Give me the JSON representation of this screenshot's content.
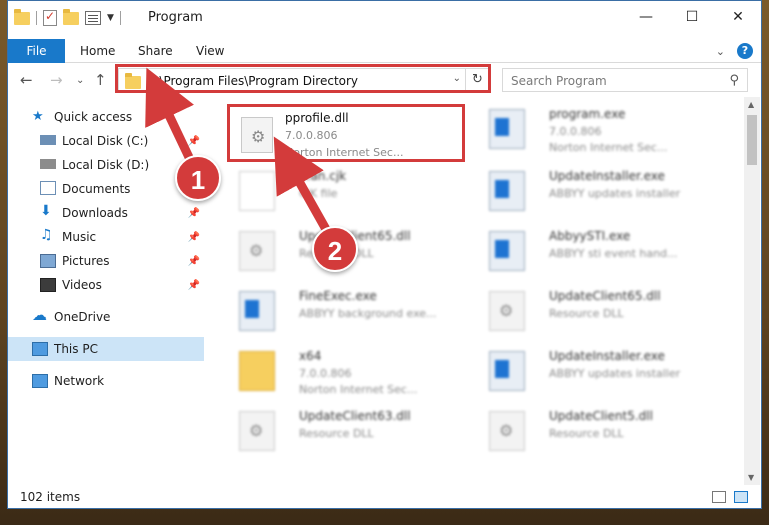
{
  "window": {
    "title": "Program"
  },
  "ribbon": {
    "tabs": [
      "File",
      "Home",
      "Share",
      "View"
    ],
    "help_icon": "?"
  },
  "navigation": {
    "address": "C:\\Program Files\\Program Directory",
    "search_placeholder": "Search Program"
  },
  "sidebar": {
    "items": [
      {
        "label": "Quick access",
        "icon": "star-icon",
        "pinned": false
      },
      {
        "label": "Local Disk (C:)",
        "icon": "drive-icon",
        "pinned": true
      },
      {
        "label": "Local Disk (D:)",
        "icon": "drive-icon",
        "pinned": false
      },
      {
        "label": "Documents",
        "icon": "documents-icon",
        "pinned": true
      },
      {
        "label": "Downloads",
        "icon": "download-icon",
        "pinned": true
      },
      {
        "label": "Music",
        "icon": "music-icon",
        "pinned": true
      },
      {
        "label": "Pictures",
        "icon": "pictures-icon",
        "pinned": true
      },
      {
        "label": "Videos",
        "icon": "videos-icon",
        "pinned": true
      },
      {
        "label": "OneDrive",
        "icon": "cloud-icon",
        "pinned": false
      },
      {
        "label": "This PC",
        "icon": "pc-icon",
        "pinned": false,
        "selected": true
      },
      {
        "label": "Network",
        "icon": "network-icon",
        "pinned": false
      }
    ]
  },
  "files": {
    "featured": {
      "name": "pprofile.dll",
      "version": "7.0.0.806",
      "company": "Norton Internet Sec..."
    },
    "blurred": [
      {
        "name": "program.exe",
        "line2": "7.0.0.806",
        "line3": "Norton Internet Sec..."
      },
      {
        "name": "...an.cjk",
        "line2": "CJK file",
        "line3": ""
      },
      {
        "name": "UpdateInstaller.exe",
        "line2": "ABBYY updates installer",
        "line3": ""
      },
      {
        "name": "UpdateClient65.dll",
        "line2": "Resource DLL",
        "line3": ""
      },
      {
        "name": "AbbyySTI.exe",
        "line2": "ABBYY sti event hand...",
        "line3": ""
      },
      {
        "name": "FineExec.exe",
        "line2": "ABBYY background exe...",
        "line3": ""
      },
      {
        "name": "UpdateClient65.dll",
        "line2": "Resource DLL",
        "line3": ""
      },
      {
        "name": "x64",
        "line2": "7.0.0.806",
        "line3": "Norton Internet Sec..."
      },
      {
        "name": "UpdateInstaller.exe",
        "line2": "ABBYY updates installer",
        "line3": ""
      },
      {
        "name": "UpdateClient63.dll",
        "line2": "Resource DLL",
        "line3": ""
      },
      {
        "name": "UpdateClient5.dll",
        "line2": "Resource DLL",
        "line3": ""
      }
    ]
  },
  "status": {
    "item_count": "102 items"
  },
  "annotations": {
    "step1": "1",
    "step2": "2",
    "color": "#d33b3b"
  }
}
